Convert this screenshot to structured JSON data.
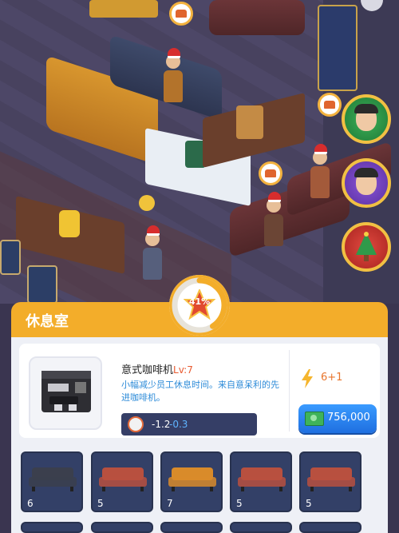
{
  "room": {
    "title": "休息室",
    "progress_percent": 41,
    "progress_label": "41%"
  },
  "item": {
    "name": "意式咖啡机",
    "level_label": "Lv:7",
    "description": "小幅减少员工休息时间。来自意呆利的先进咖啡机。",
    "effect_base": "-1.2",
    "effect_delta": "-0.3",
    "energy": "6+1",
    "price": "756,000"
  },
  "slots": [
    {
      "color": "#3b3f4d",
      "qty": "6"
    },
    {
      "color": "#b8503f",
      "qty": "5"
    },
    {
      "color": "#d98b2a",
      "qty": "7"
    },
    {
      "color": "#b8503f",
      "qty": "5"
    },
    {
      "color": "#b8503f",
      "qty": "5"
    }
  ],
  "colors": {
    "accent": "#f3ad2a",
    "level": "#e85a30",
    "desc": "#2d8bd8",
    "buy_button": "#1f6fe0"
  },
  "icons": [
    "bolt-icon",
    "cash-icon",
    "clock-icon",
    "coffee-machine-icon",
    "star-badge-icon",
    "chair-bubble-icon"
  ]
}
